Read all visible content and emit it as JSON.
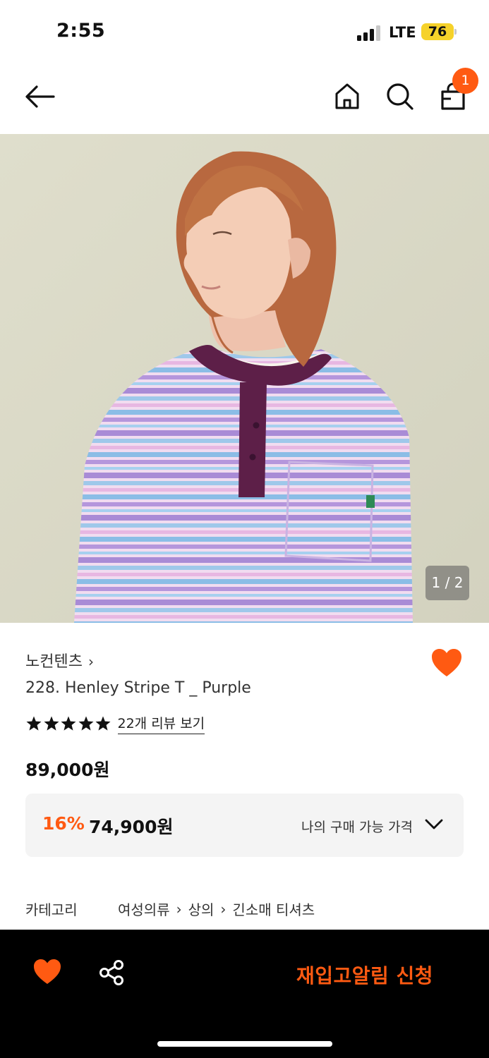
{
  "status_bar": {
    "time": "2:55",
    "network": "LTE",
    "battery": "76",
    "battery_color": "#f6d22a"
  },
  "nav": {
    "back_icon": "arrow-left-icon",
    "home_icon": "home-icon",
    "search_icon": "search-icon",
    "cart_icon": "shopping-bag-icon",
    "cart_count": "1"
  },
  "gallery": {
    "counter": "1 / 2"
  },
  "product": {
    "brand": "노컨텐츠",
    "brand_chevron": "›",
    "name": "228. Henley Stripe T _ Purple",
    "rating_stars": 5,
    "review_link": "22개 리뷰 보기",
    "original_price": "89,000원",
    "discount_percent": "16%",
    "discount_price": "74,900원",
    "my_price_label": "나의 구매 가능 가격",
    "liked": true
  },
  "category": {
    "label": "카테고리",
    "path": [
      "여성의류",
      "상의",
      "긴소매 티셔츠"
    ],
    "separator": "›"
  },
  "bottom_bar": {
    "like_icon": "heart-icon",
    "share_icon": "share-icon",
    "restock_label": "재입고알림 신청"
  },
  "colors": {
    "accent": "#ff5a12",
    "bottom_bar_bg": "#000000"
  }
}
